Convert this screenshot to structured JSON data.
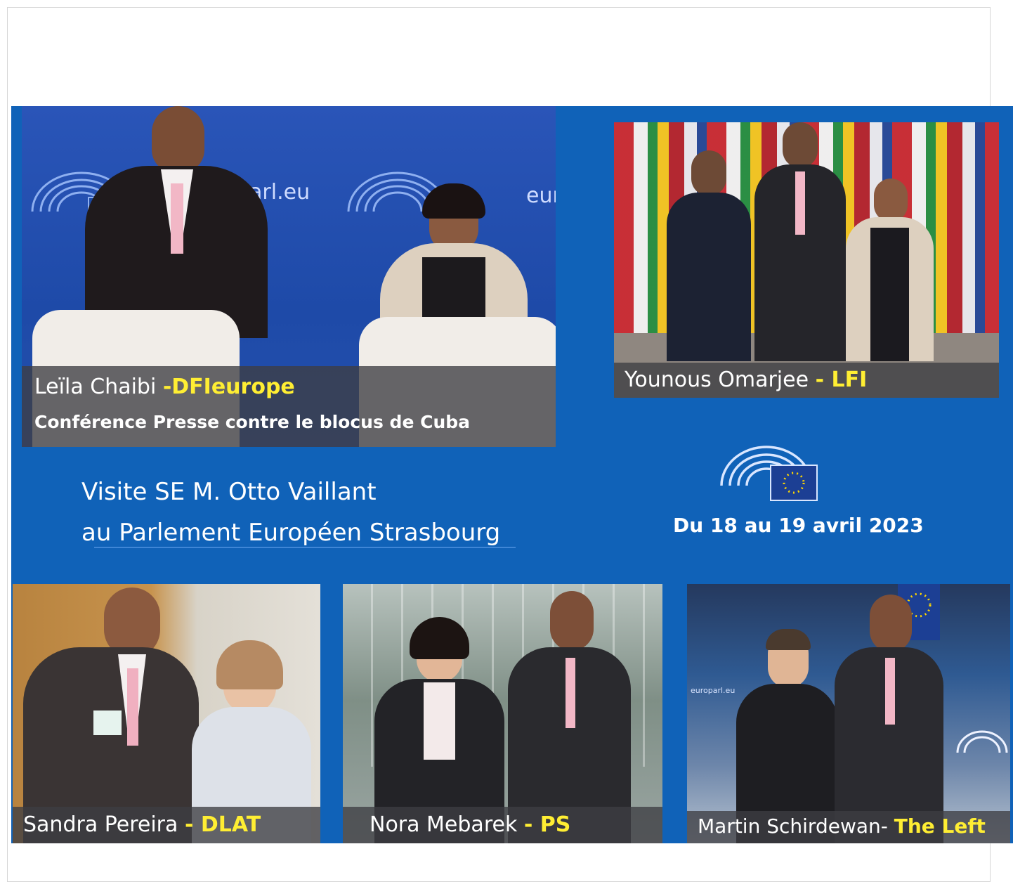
{
  "photos": {
    "top_left": {
      "backdrop_text_1": "parl.eu",
      "backdrop_text_2": "euro",
      "caption_name": "Leïla Chaibi ",
      "caption_party": "-DFIeurope",
      "caption_line2": "Conférence Presse contre le blocus de Cuba"
    },
    "top_right": {
      "caption_name": "Younous Omarjee ",
      "caption_party": "- LFI"
    },
    "bottom_left": {
      "caption_name": "Sandra Pereira ",
      "caption_party": "- DLAT"
    },
    "bottom_middle": {
      "caption_name": "Nora Mebarek ",
      "caption_party": "- PS"
    },
    "bottom_right": {
      "caption_name": "Martin Schirdewan- ",
      "caption_party": "The Left",
      "backdrop_text": "europarl.eu"
    }
  },
  "headline": {
    "line1": "Visite SE M. Otto Vaillant",
    "line2": "au Parlement Européen Strasbourg"
  },
  "date_text": "Du 18 au 19 avril 2023",
  "colors": {
    "poster_blue": "#1062b8",
    "highlight_yellow": "#ffee33",
    "caption_grey": "#3e3e42"
  },
  "icons": [
    "european-parliament-logo",
    "eu-flag"
  ]
}
